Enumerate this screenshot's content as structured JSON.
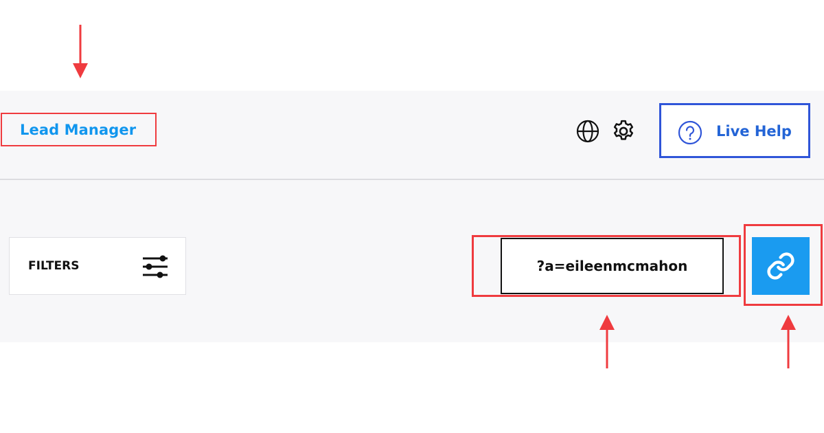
{
  "header": {
    "app_title": "Lead Manager",
    "language_icon": "globe-icon",
    "settings_icon": "gear-icon",
    "live_help": {
      "label": "Live Help",
      "icon": "question-circle-icon"
    }
  },
  "toolbar": {
    "filters": {
      "label": "FILTERS",
      "icon": "sliders-icon"
    },
    "query_string": "?a=eileenmcmahon",
    "copy_link": {
      "icon": "link-icon"
    }
  },
  "colors": {
    "accent_blue": "#1196ee",
    "link_button_bg": "#1a9bf0",
    "live_help_border": "#2f55d8",
    "annotation_red": "#ef3b3f",
    "panel_bg": "#f7f7f9"
  }
}
